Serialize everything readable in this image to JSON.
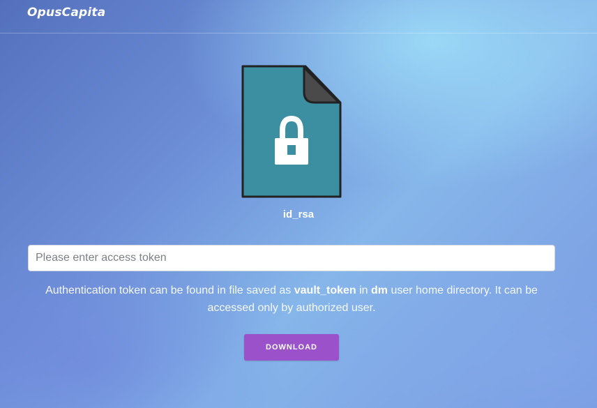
{
  "header": {
    "logo_text": "OpusCapita"
  },
  "file": {
    "name": "id_rsa",
    "icon": "locked-file-icon",
    "icon_color": "#3b8fa0",
    "fold_color": "#4a4a4a"
  },
  "token_input": {
    "value": "",
    "placeholder": "Please enter access token"
  },
  "help": {
    "part1": "Authentication token can be found in file saved as ",
    "file_name": "vault_token",
    "part2": " in ",
    "user": "dm",
    "part3": " user home directory. It can be accessed only by authorized user."
  },
  "download_button": {
    "label": "DOWNLOAD",
    "color": "#9b51c9"
  }
}
